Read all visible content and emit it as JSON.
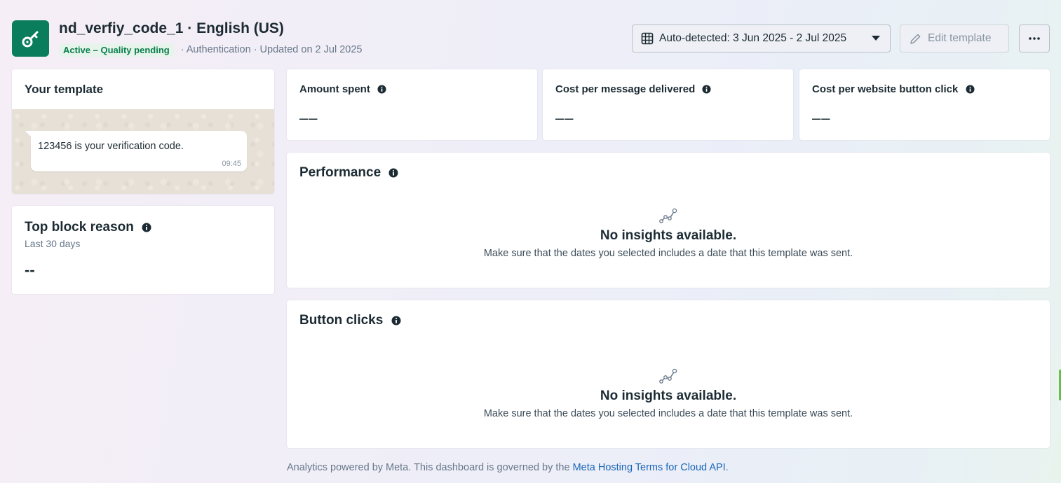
{
  "header": {
    "title": "nd_verfiy_code_1 · English (US)",
    "status": "Active – Quality pending",
    "meta": "· Authentication · Updated on 2 Jul 2025",
    "date_range": "Auto-detected: 3 Jun 2025 - 2 Jul 2025",
    "edit_label": "Edit template",
    "app_icon": "key-icon"
  },
  "template_card": {
    "title": "Your template",
    "message": "123456 is your verification code.",
    "time": "09:45"
  },
  "block_card": {
    "title": "Top block reason",
    "subtitle": "Last 30 days",
    "value": "--"
  },
  "metrics": [
    {
      "label": "Amount spent",
      "value": "––"
    },
    {
      "label": "Cost per message delivered",
      "value": "––"
    },
    {
      "label": "Cost per website button click",
      "value": "––"
    }
  ],
  "performance": {
    "title": "Performance",
    "empty_title": "No insights available.",
    "empty_sub": "Make sure that the dates you selected includes a date that this template was sent."
  },
  "button_clicks": {
    "title": "Button clicks",
    "empty_title": "No insights available.",
    "empty_sub": "Make sure that the dates you selected includes a date that this template was sent."
  },
  "footer": {
    "text": "Analytics powered by Meta. This dashboard is governed by the ",
    "link": "Meta Hosting Terms for Cloud API",
    "end": "."
  },
  "colors": {
    "brand": "#0a7d5d",
    "status_green": "#0a7d4a",
    "link": "#1a66b8"
  }
}
